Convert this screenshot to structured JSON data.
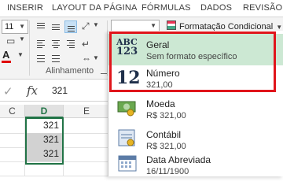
{
  "ribbon": {
    "tabs": [
      "INSERIR",
      "LAYOUT DA PÁGINA",
      "FÓRMULAS",
      "DADOS",
      "REVISÃO"
    ],
    "font_size": "11",
    "alignment_group_label": "Alinhamento",
    "conditional_formatting_label": "Formatação Condicional",
    "accent_color": "#217346",
    "font_color_swatch": "#e00000"
  },
  "formula_bar": {
    "fx_label": "fx",
    "value": "321"
  },
  "sheet": {
    "columns": [
      "C",
      "D",
      "E"
    ],
    "selected_column": "D",
    "selected_cells": [
      "321",
      "321",
      "321"
    ]
  },
  "number_format_menu": {
    "highlight_color": "#e0151b",
    "hover_color": "#cce8d3",
    "options": [
      {
        "title": "Geral",
        "subtitle": "Sem formato específico",
        "icon": "general-abc-123-icon",
        "icon_text_1": "ABC",
        "icon_text_2": "123"
      },
      {
        "title": "Número",
        "subtitle": "321,00",
        "icon": "number-12-icon",
        "icon_text": "12"
      },
      {
        "title": "Moeda",
        "subtitle": "R$ 321,00",
        "icon": "currency-icon"
      },
      {
        "title": "Contábil",
        "subtitle": "R$ 321,00",
        "icon": "accounting-icon"
      },
      {
        "title": "Data Abreviada",
        "subtitle": "16/11/1900",
        "icon": "short-date-icon"
      }
    ]
  }
}
